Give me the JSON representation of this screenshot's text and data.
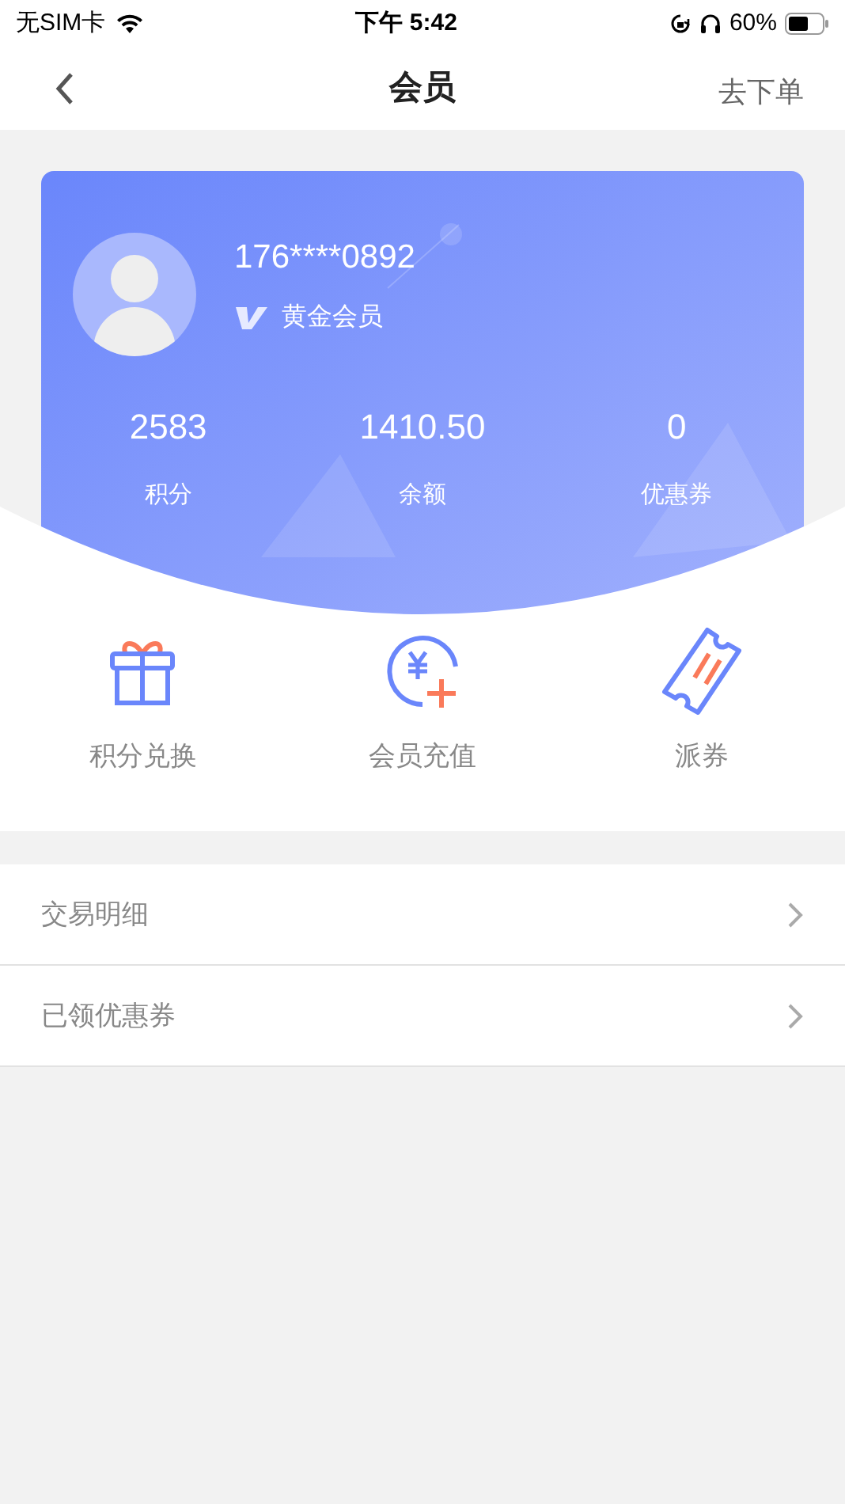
{
  "status_bar": {
    "carrier": "无SIM卡",
    "time": "下午 5:42",
    "battery": "60%"
  },
  "nav": {
    "title": "会员",
    "action": "去下单"
  },
  "member": {
    "phone": "176****0892",
    "level": "黄金会员"
  },
  "stats": [
    {
      "value": "2583",
      "label": "积分"
    },
    {
      "value": "1410.50",
      "label": "余额"
    },
    {
      "value": "0",
      "label": "优惠券"
    }
  ],
  "actions": [
    {
      "kind": "gift",
      "label": "积分兑换"
    },
    {
      "kind": "recharge",
      "label": "会员充值"
    },
    {
      "kind": "ticket",
      "label": "派券"
    }
  ],
  "menu": [
    {
      "label": "交易明细"
    },
    {
      "label": "已领优惠券"
    }
  ]
}
